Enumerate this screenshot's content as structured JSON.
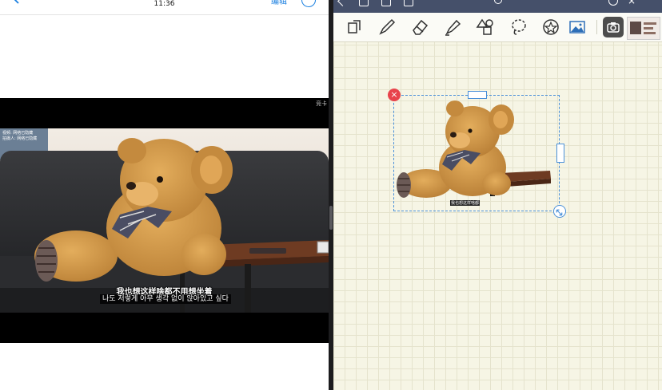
{
  "left": {
    "status_time": "11:36",
    "edit_label": "编辑",
    "video": {
      "corner_tag": "竞卡",
      "meta_lines": [
        "视频: 网络已隐藏",
        "拍摄人: 网络已隐藏"
      ],
      "subtitle_zh": "我也想这样啥都不用想坐着",
      "subtitle_ko": "나도 저렇게 아무 생각 없이 앉아있고 싶다"
    }
  },
  "right": {
    "toolbar": {
      "tools": [
        "lasso-select-tool",
        "pen-tool",
        "eraser-tool",
        "highlighter-tool",
        "shapes-tool",
        "lasso-tool",
        "sticker-tool",
        "image-tool",
        "camera-tool"
      ],
      "selected_tool": "camera-tool"
    },
    "sticker": {
      "caption": "我也想这样啥都"
    },
    "colors": {
      "topbar": "#45506a",
      "paper": "#f6f5e5",
      "grid": "#e5e3cd",
      "selection": "#4a90d9",
      "delete": "#e8434b"
    }
  }
}
